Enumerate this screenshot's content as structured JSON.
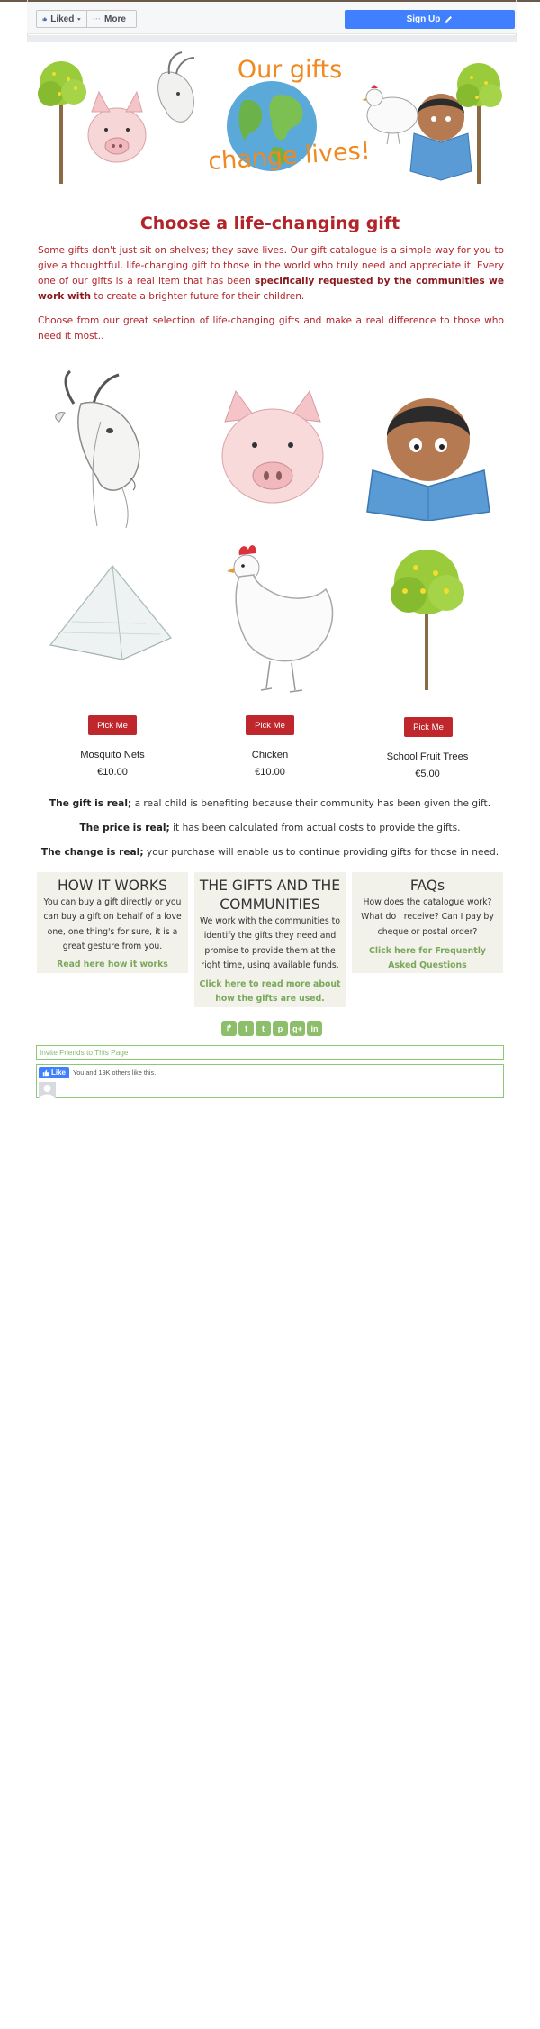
{
  "toolbar": {
    "liked_label": "Liked",
    "more_label": "More",
    "signup_label": "Sign Up"
  },
  "banner": {
    "title_line1": "Our gifts",
    "title_line2": "change lives!"
  },
  "main": {
    "heading": "Choose a life-changing gift",
    "intro_p1_a": "Some gifts don't just sit on shelves; they save lives. Our gift catalogue is a simple way for you to give a thoughtful, life-changing gift to those in the world who truly need and appreciate it. Every one of our gifts is a real item that has been ",
    "intro_p1_b": "specifically requested by the communities we work with",
    "intro_p1_c": " to create a brighter future for their children.",
    "intro_p2": "Choose from our great selection of life-changing gifts and make a real difference to those who need it most.."
  },
  "gifts": [
    {
      "name": "Mosquito Nets",
      "price": "€10.00",
      "button": "Pick Me"
    },
    {
      "name": "Chicken",
      "price": "€10.00",
      "button": "Pick Me"
    },
    {
      "name": "School Fruit Trees",
      "price": "€5.00",
      "button": "Pick Me"
    }
  ],
  "statements": [
    {
      "bold": "The gift is real;",
      "rest": " a real child is benefiting because their community has been given the gift."
    },
    {
      "bold": "The price is real;",
      "rest": " it has been calculated from actual costs to provide the gifts."
    },
    {
      "bold": "The change is real;",
      "rest": " your purchase will enable us to continue providing gifts for those in need."
    }
  ],
  "info_boxes": [
    {
      "title": "HOW IT WORKS",
      "text": "You can buy a gift directly or you can buy a gift on behalf of a love one, one thing's for sure, it is a great gesture from you.",
      "link": "Read here how it works"
    },
    {
      "title": "THE GIFTS AND THE COMMUNITIES",
      "text": "We work with the communities to identify the gifts they need and promise to provide them at the right time, using available funds.",
      "link": "Click here to read more about how the gifts are used."
    },
    {
      "title": "FAQs",
      "text": "How does the catalogue work? What do I receive? Can I pay by cheque or postal order?",
      "link": "Click here for Frequently Asked Questions"
    }
  ],
  "share_icons": [
    "share-icon",
    "facebook-icon",
    "twitter-icon",
    "pinterest-icon",
    "googleplus-icon",
    "linkedin-icon"
  ],
  "social": {
    "invite_label": "Invite Friends to This Page",
    "like_label": "Like",
    "like_count": "You and 19K others like this."
  },
  "colors": {
    "brand_red": "#b3242a",
    "button_red": "#c0272d",
    "fb_blue": "#4080ff",
    "link_green": "#7aa85a",
    "box_bg": "#f2f1ea",
    "banner_orange": "#f0891f"
  }
}
